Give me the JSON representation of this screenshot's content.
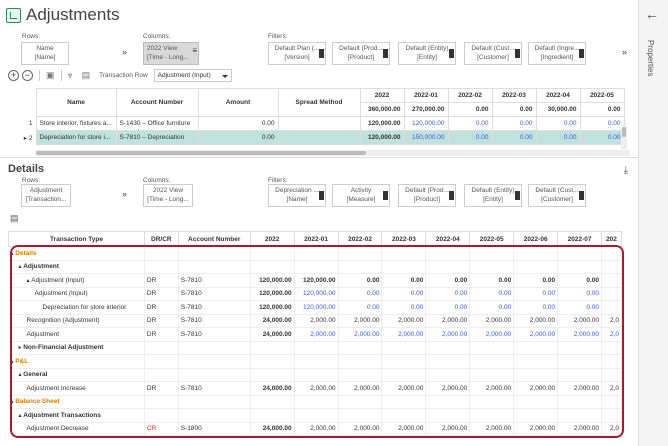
{
  "page": {
    "title": "Adjustments",
    "properties_label": "Properties"
  },
  "top_pivot": {
    "rows_label": "Rows:",
    "row_pill": [
      "Name",
      "[Name]"
    ],
    "columns_label": "Columns:",
    "column_pill": [
      "2022 View",
      "[Time - Long..."
    ],
    "filters_label": "Filters:",
    "filters": [
      [
        "Default Plan (...",
        "[Version]"
      ],
      [
        "Default (Prod...",
        "[Product]"
      ],
      [
        "Default (Entity)",
        "[Entity]"
      ],
      [
        "Default (Cust...",
        "[Customer]"
      ],
      [
        "Default (Ingre...",
        "[Ingredient]"
      ]
    ]
  },
  "toolbar": {
    "transaction_row_label": "Transaction Row",
    "transaction_row_value": "Adjustment (Input)"
  },
  "top_table": {
    "headers": [
      "Name",
      "Account Number",
      "Amount",
      "Spread Method",
      "2022",
      "2022-01",
      "2022-02",
      "2022-03",
      "2022-04",
      "2022-05"
    ],
    "totals": [
      "360,000.00",
      "270,000.00",
      "0.00",
      "0.00",
      "30,000.00",
      "0.00"
    ],
    "rows": [
      {
        "num": "1",
        "name": "Store interior, fixtures a...",
        "account": "S-1430 – Office furniture",
        "amount": "0.00",
        "values": [
          "120,000.00",
          "120,000.00",
          "0.00",
          "0.00",
          "0.00",
          "0.00"
        ]
      },
      {
        "num": "2",
        "name": "Depreciation for store i...",
        "account": "S-7810 – Depreciation",
        "amount": "0.00",
        "values": [
          "120,000.00",
          "150,000.00",
          "0.00",
          "0.00",
          "0.00",
          "0.00"
        ]
      }
    ]
  },
  "details": {
    "title": "Details",
    "rows_label": "Rows:",
    "row_pill": [
      "Adjustment",
      "[Transaction..."
    ],
    "columns_label": "Columns:",
    "column_pill": [
      "2022 View",
      "[Time - Long..."
    ],
    "filters_label": "Filters:",
    "filters": [
      [
        "Depreciation ...",
        "[Name]"
      ],
      [
        "Activity",
        "[Measure]"
      ],
      [
        "Default (Prod...",
        "[Product]"
      ],
      [
        "Default (Entity)",
        "[Entity]"
      ],
      [
        "Default (Cust...",
        "[Customer]"
      ]
    ],
    "headers": [
      "Transaction Type",
      "DR/CR",
      "Account Number",
      "2022",
      "2022-01",
      "2022-02",
      "2022-03",
      "2022-04",
      "2022-05",
      "2022-06",
      "2022-07",
      "202"
    ],
    "rows": [
      {
        "label": "Details",
        "indent": 0,
        "arrow": "▴",
        "style": "orange",
        "drcr": "",
        "acct": "",
        "v": []
      },
      {
        "label": "Adjustment",
        "indent": 1,
        "arrow": "▴",
        "style": "bold",
        "drcr": "",
        "acct": "",
        "v": []
      },
      {
        "label": "Adjustment (Input)",
        "indent": 2,
        "arrow": "▴",
        "style": "",
        "drcr": "DR",
        "acct": "S-7810",
        "v": [
          "120,000.00",
          "120,000.00",
          "0.00",
          "0.00",
          "0.00",
          "0.00",
          "0.00",
          "0.00",
          ""
        ],
        "bold_vals": true
      },
      {
        "label": "Adjustment (Input)",
        "indent": 3,
        "arrow": "",
        "style": "",
        "drcr": "DR",
        "acct": "S-7810",
        "v": [
          "120,000.00",
          "120,000.00",
          "0.00",
          "0.00",
          "0.00",
          "0.00",
          "0.00",
          "0.00",
          ""
        ],
        "blue_vals": true
      },
      {
        "label": "Depreciation for store interior",
        "indent": 4,
        "arrow": "",
        "style": "",
        "drcr": "DR",
        "acct": "S-7810",
        "v": [
          "120,000.00",
          "120,000.00",
          "0.00",
          "0.00",
          "0.00",
          "0.00",
          "0.00",
          "0.00",
          ""
        ],
        "blue_vals": true
      },
      {
        "label": "Recognition (Adjustment)",
        "indent": 2,
        "arrow": "",
        "style": "",
        "drcr": "DR",
        "acct": "S-7810",
        "v": [
          "24,000.00",
          "2,000.00",
          "2,000.00",
          "2,000.00",
          "2,000.00",
          "2,000.00",
          "2,000.00",
          "2,000.00",
          "2,0"
        ]
      },
      {
        "label": "Adjustment",
        "indent": 2,
        "arrow": "",
        "style": "",
        "drcr": "DR",
        "acct": "S-7810",
        "v": [
          "24,000.00",
          "2,000.00",
          "2,000.00",
          "2,000.00",
          "2,000.00",
          "2,000.00",
          "2,000.00",
          "2,000.00",
          "2,0"
        ],
        "blue_vals": true
      },
      {
        "label": "Non-Financial Adjustment",
        "indent": 1,
        "arrow": "▸",
        "style": "bold",
        "drcr": "",
        "acct": "",
        "v": []
      },
      {
        "label": "P&L",
        "indent": 0,
        "arrow": "▴",
        "style": "orange",
        "drcr": "",
        "acct": "",
        "v": []
      },
      {
        "label": "General",
        "indent": 1,
        "arrow": "▴",
        "style": "bold",
        "drcr": "",
        "acct": "",
        "v": []
      },
      {
        "label": "Adjustment Increase",
        "indent": 2,
        "arrow": "",
        "style": "",
        "drcr": "DR",
        "acct": "S-7810",
        "v": [
          "24,000.00",
          "2,000.00",
          "2,000.00",
          "2,000.00",
          "2,000.00",
          "2,000.00",
          "2,000.00",
          "2,000.00",
          "2,0"
        ]
      },
      {
        "label": "Balance Sheet",
        "indent": 0,
        "arrow": "▴",
        "style": "orange",
        "drcr": "",
        "acct": "",
        "v": []
      },
      {
        "label": "Adjustment Transactions",
        "indent": 1,
        "arrow": "▴",
        "style": "bold",
        "drcr": "",
        "acct": "",
        "v": []
      },
      {
        "label": "Adjustment Decrease",
        "indent": 2,
        "arrow": "",
        "style": "",
        "drcr": "CR",
        "acct": "S-1800",
        "v": [
          "24,000.00",
          "2,000.00",
          "2,000.00",
          "2,000.00",
          "2,000.00",
          "2,000.00",
          "2,000.00",
          "2,000.00",
          "2,0"
        ]
      }
    ]
  },
  "colors": {
    "accent": "#2e8b57",
    "highlight_border": "#a61c2e",
    "selected_row": "#bfe2dd",
    "category_orange": "#e07b00",
    "value_blue": "#3b5bd9"
  }
}
